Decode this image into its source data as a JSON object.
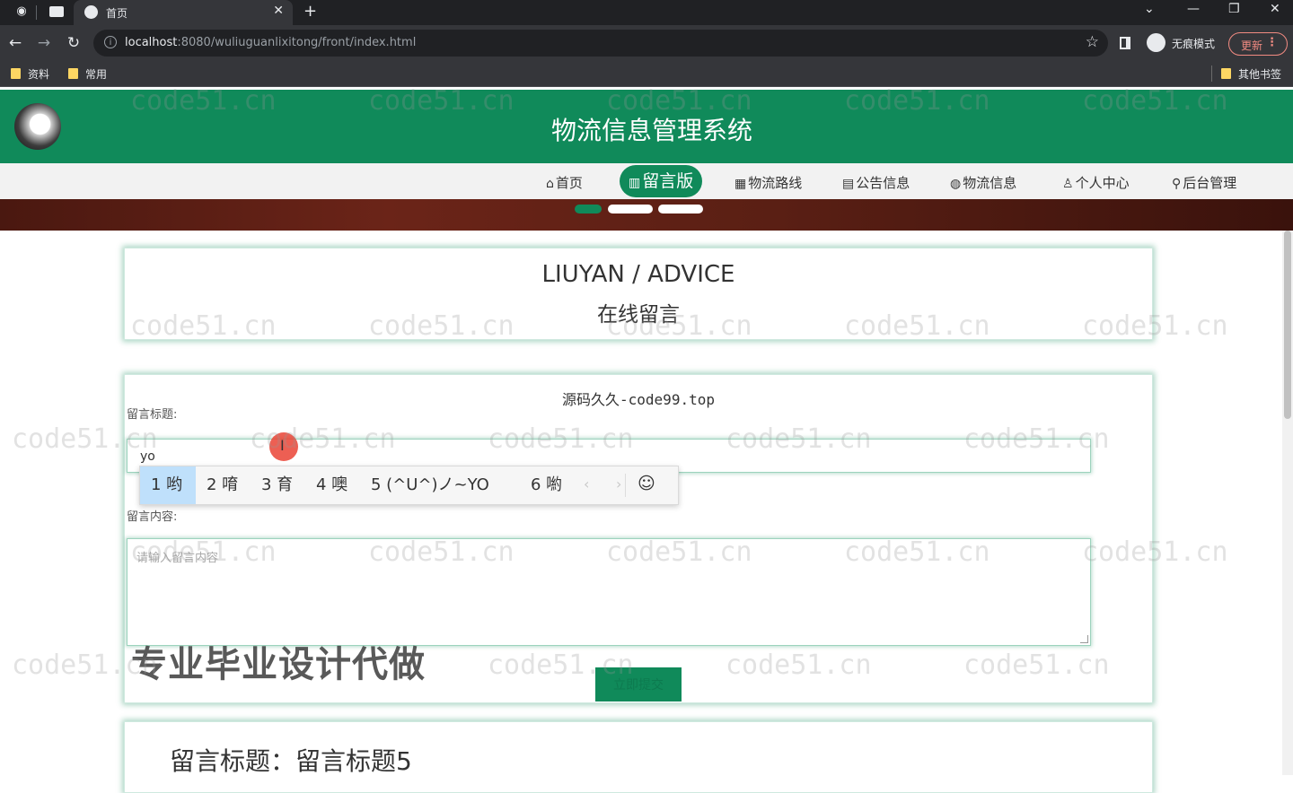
{
  "browser": {
    "tab_title": "首页",
    "url_host": "localhost",
    "url_rest": ":8080/wuliuguanlixitong/front/index.html",
    "incognito_label": "无痕模式",
    "update_label": "更新",
    "bookmarks": [
      "资料",
      "常用"
    ],
    "other_bookmarks": "其他书签"
  },
  "site": {
    "title": "物流信息管理系统"
  },
  "nav": {
    "items": [
      {
        "icon": "⌂",
        "label": "首页"
      },
      {
        "icon": "▥",
        "label": "留言版"
      },
      {
        "icon": "▦",
        "label": "物流路线"
      },
      {
        "icon": "▤",
        "label": "公告信息"
      },
      {
        "icon": "◍",
        "label": "物流信息"
      },
      {
        "icon": "♙",
        "label": "个人中心"
      },
      {
        "icon": "⚲",
        "label": "后台管理"
      }
    ]
  },
  "section_heading": {
    "title": "LIUYAN / ADVICE",
    "subtitle": "在线留言"
  },
  "form": {
    "notice": "源码久久-code99.top",
    "title_label": "留言标题:",
    "title_value": "yo",
    "content_label": "留言内容:",
    "content_placeholder": "请输入留言内容",
    "submit_label": "立即提交"
  },
  "ime": {
    "candidates": [
      "1 哟",
      "2 唷",
      "3 育",
      "4 噢",
      "5 (^U^)ノ~YO",
      "6 喲"
    ],
    "emoji": "☺"
  },
  "overlay_text": "专业毕业设计代做",
  "watermark": "code51.cn",
  "message": {
    "title": "留言标题：留言标题5"
  },
  "colors": {
    "accent": "#108a5a",
    "header_bg": "#108a5a",
    "nav_bg": "#f2f2f2"
  }
}
